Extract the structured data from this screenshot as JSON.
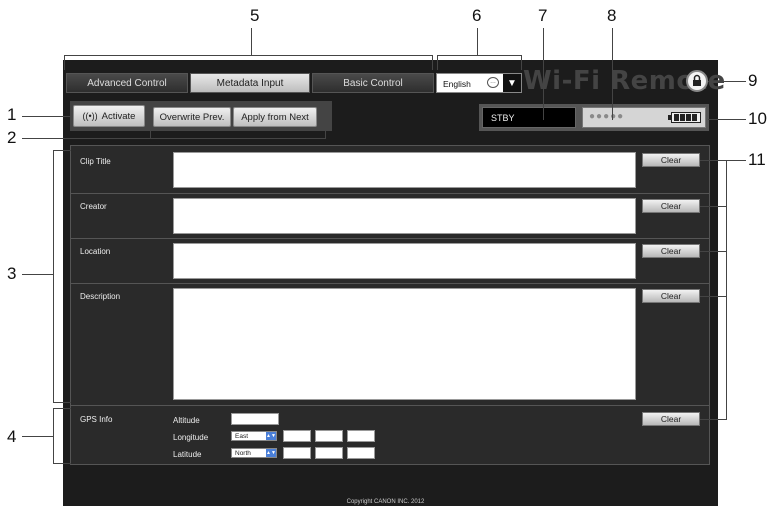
{
  "callouts": [
    "1",
    "2",
    "3",
    "4",
    "5",
    "6",
    "7",
    "8",
    "9",
    "10",
    "11"
  ],
  "tabs": [
    {
      "label": "Advanced Control"
    },
    {
      "label": "Metadata Input"
    },
    {
      "label": "Basic Control"
    }
  ],
  "language": {
    "value": "English",
    "menu_arrow": "▼"
  },
  "brand": {
    "title": "Wi-Fi Remote"
  },
  "toolbar": {
    "activate_label": "Activate",
    "overwrite_label": "Overwrite Prev.",
    "apply_label": "Apply from Next"
  },
  "status": {
    "mode": "STBY",
    "dots": "●●●●●"
  },
  "fields": [
    {
      "label": "Clip Title",
      "clear": "Clear"
    },
    {
      "label": "Creator",
      "clear": "Clear"
    },
    {
      "label": "Location",
      "clear": "Clear"
    },
    {
      "label": "Description",
      "clear": "Clear"
    }
  ],
  "gps": {
    "label": "GPS Info",
    "altitude_label": "Altitude",
    "longitude_label": "Longitude",
    "latitude_label": "Latitude",
    "longitude_dir": "East",
    "latitude_dir": "North",
    "clear": "Clear"
  },
  "footer": {
    "copyright": "Copyright CANON INC. 2012"
  },
  "colors": {
    "accent": "#4a7fd8",
    "background": "#1c1c1c",
    "panel": "#2a2a2a"
  }
}
